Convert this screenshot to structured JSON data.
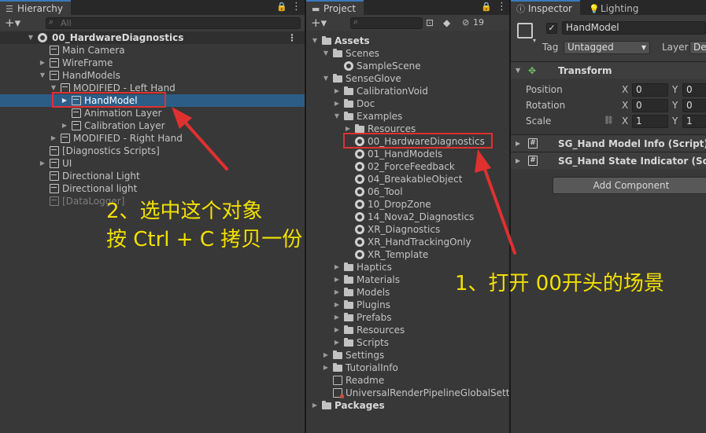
{
  "hierarchy": {
    "tab_label": "Hierarchy",
    "search_placeholder": "All",
    "rows": [
      {
        "label": "00_HardwareDiagnostics",
        "kind": "scene"
      },
      {
        "label": "Main Camera"
      },
      {
        "label": "WireFrame"
      },
      {
        "label": "HandModels"
      },
      {
        "label": "MODIFIED - Left Hand"
      },
      {
        "label": "HandModel",
        "selected": true
      },
      {
        "label": "Animation Layer"
      },
      {
        "label": "Calibration Layer"
      },
      {
        "label": "MODIFIED - Right Hand"
      },
      {
        "label": "[Diagnostics Scripts]"
      },
      {
        "label": "UI"
      },
      {
        "label": "Directional Light"
      },
      {
        "label": "Directional light"
      },
      {
        "label": "[DataLogger]",
        "inactive": true
      }
    ]
  },
  "project": {
    "tab_label": "Project",
    "item_count": "19",
    "rows": [
      {
        "label": "Assets"
      },
      {
        "label": "Scenes"
      },
      {
        "label": "SampleScene"
      },
      {
        "label": "SenseGlove"
      },
      {
        "label": "CalibrationVoid"
      },
      {
        "label": "Doc"
      },
      {
        "label": "Examples"
      },
      {
        "label": "Resources"
      },
      {
        "label": "00_HardwareDiagnostics",
        "highlighted": true
      },
      {
        "label": "01_HandModels"
      },
      {
        "label": "02_ForceFeedback"
      },
      {
        "label": "04_BreakableObject"
      },
      {
        "label": "06_Tool"
      },
      {
        "label": "10_DropZone"
      },
      {
        "label": "14_Nova2_Diagnostics"
      },
      {
        "label": "XR_Diagnostics"
      },
      {
        "label": "XR_HandTrackingOnly"
      },
      {
        "label": "XR_Template"
      },
      {
        "label": "Haptics"
      },
      {
        "label": "Materials"
      },
      {
        "label": "Models"
      },
      {
        "label": "Plugins"
      },
      {
        "label": "Prefabs"
      },
      {
        "label": "Resources"
      },
      {
        "label": "Scripts"
      },
      {
        "label": "Settings"
      },
      {
        "label": "TutorialInfo"
      },
      {
        "label": "Readme"
      },
      {
        "label": "UniversalRenderPipelineGlobalSettings"
      },
      {
        "label": "Packages"
      }
    ]
  },
  "inspector": {
    "tab_label": "Inspector",
    "lighting_tab_label": "Lighting",
    "object_name": "HandModel",
    "active_checked": true,
    "tag_label": "Tag",
    "tag_value": "Untagged",
    "layer_label": "Layer",
    "layer_value": "De",
    "transform_title": "Transform",
    "position_label": "Position",
    "rotation_label": "Rotation",
    "scale_label": "Scale",
    "x_axis": "X",
    "y_axis": "Y",
    "position": {
      "x": "0",
      "y": "0"
    },
    "rotation": {
      "x": "0",
      "y": "0"
    },
    "scale": {
      "x": "1",
      "y": "1"
    },
    "component1": "SG_Hand Model Info (Script)",
    "component2": "SG_Hand State Indicator (Script)",
    "add_component": "Add Component"
  },
  "annotations": {
    "step2_line1": "2、选中这个对象",
    "step2_line2": "按 Ctrl + C 拷贝一份",
    "step1": "1、打开 00开头的场景",
    "color": "#f2e000",
    "box_color": "#e03030"
  },
  "colors": {
    "panel_bg": "#383838",
    "selection": "#2c5d87",
    "tab_accent": "#3a79bb"
  }
}
